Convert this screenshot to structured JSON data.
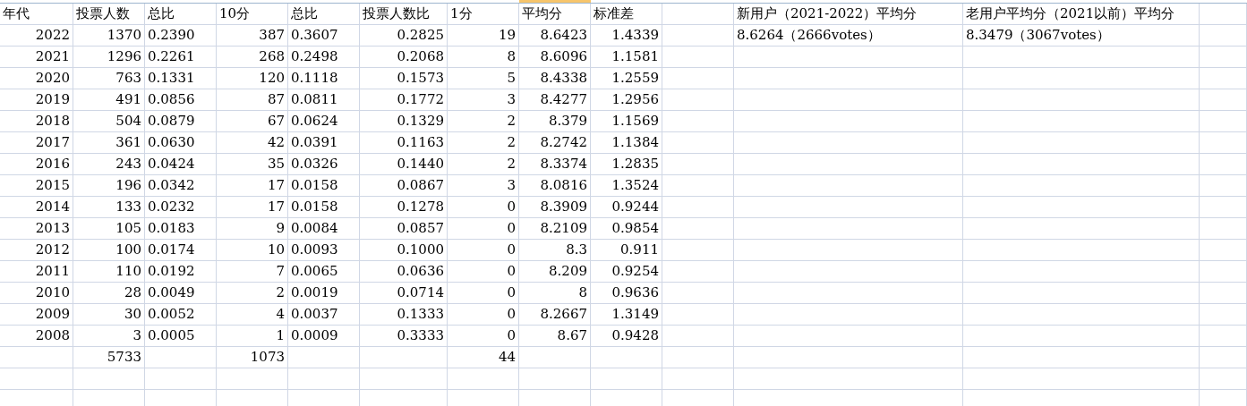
{
  "sheet": {
    "header": [
      "年代",
      "投票人数",
      "总比",
      "10分",
      "总比",
      "投票人数比",
      "1分",
      "平均分",
      "标准差"
    ],
    "rows": [
      [
        "2022",
        "1370",
        "0.2390",
        "387",
        "0.3607",
        "0.2825",
        "19",
        "8.6423",
        "1.4339"
      ],
      [
        "2021",
        "1296",
        "0.2261",
        "268",
        "0.2498",
        "0.2068",
        "8",
        "8.6096",
        "1.1581"
      ],
      [
        "2020",
        "763",
        "0.1331",
        "120",
        "0.1118",
        "0.1573",
        "5",
        "8.4338",
        "1.2559"
      ],
      [
        "2019",
        "491",
        "0.0856",
        "87",
        "0.0811",
        "0.1772",
        "3",
        "8.4277",
        "1.2956"
      ],
      [
        "2018",
        "504",
        "0.0879",
        "67",
        "0.0624",
        "0.1329",
        "2",
        "8.379",
        "1.1569"
      ],
      [
        "2017",
        "361",
        "0.0630",
        "42",
        "0.0391",
        "0.1163",
        "2",
        "8.2742",
        "1.1384"
      ],
      [
        "2016",
        "243",
        "0.0424",
        "35",
        "0.0326",
        "0.1440",
        "2",
        "8.3374",
        "1.2835"
      ],
      [
        "2015",
        "196",
        "0.0342",
        "17",
        "0.0158",
        "0.0867",
        "3",
        "8.0816",
        "1.3524"
      ],
      [
        "2014",
        "133",
        "0.0232",
        "17",
        "0.0158",
        "0.1278",
        "0",
        "8.3909",
        "0.9244"
      ],
      [
        "2013",
        "105",
        "0.0183",
        "9",
        "0.0084",
        "0.0857",
        "0",
        "8.2109",
        "0.9854"
      ],
      [
        "2012",
        "100",
        "0.0174",
        "10",
        "0.0093",
        "0.1000",
        "0",
        "8.3",
        "0.911"
      ],
      [
        "2011",
        "110",
        "0.0192",
        "7",
        "0.0065",
        "0.0636",
        "0",
        "8.209",
        "0.9254"
      ],
      [
        "2010",
        "28",
        "0.0049",
        "2",
        "0.0019",
        "0.0714",
        "0",
        "8",
        "0.9636"
      ],
      [
        "2009",
        "30",
        "0.0052",
        "4",
        "0.0037",
        "0.1333",
        "0",
        "8.2667",
        "1.3149"
      ],
      [
        "2008",
        "3",
        "0.0005",
        "1",
        "0.0009",
        "0.3333",
        "0",
        "8.67",
        "0.9428"
      ]
    ],
    "totals": {
      "votes": "5733",
      "ten": "1073",
      "one": "44"
    },
    "side": [
      {
        "header": "新用户（2021-2022）平均分",
        "value": "8.6264（2666votes）"
      },
      {
        "header": "老用户平均分（2021以前）平均分",
        "value": "8.3479（3067votes）"
      }
    ]
  }
}
